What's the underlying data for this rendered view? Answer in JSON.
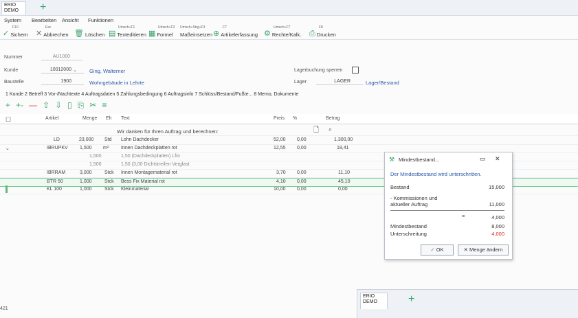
{
  "app": {
    "tab_title_line1": "ERIO",
    "tab_title_line2": "DEMO",
    "new_tab": "+"
  },
  "menu": [
    "System",
    "Bearbeiten",
    "Ansicht",
    "Funktionen"
  ],
  "toolbar": [
    {
      "key": "F10",
      "label": "Sichern",
      "icon": "check-icon",
      "color": "#3aa36a"
    },
    {
      "key": "Esc",
      "label": "Abbrechen",
      "icon": "close-icon",
      "color": "#777"
    },
    {
      "key": "",
      "label": "Löschen",
      "icon": "trash-icon",
      "color": "#3aa36a"
    },
    {
      "key": "Umsch+F1",
      "label": "Texteditieren",
      "icon": "text-edit-icon",
      "color": "#3aa36a"
    },
    {
      "key": "Umsch+F3",
      "label": "Formel",
      "icon": "formula-icon",
      "color": "#3aa36a"
    },
    {
      "key": "Umsch+Strg+F3",
      "label": "Maßeinsetzen",
      "icon": "measure-icon",
      "color": "#3aa36a"
    },
    {
      "key": "F7",
      "label": "Artikelerfassung",
      "icon": "add-circle-icon",
      "color": "#3aa36a"
    },
    {
      "key": "Umsch+F7",
      "label": "Rechte/Kalk.",
      "icon": "gear-icon",
      "color": "#3aa36a"
    },
    {
      "key": "F8",
      "label": "Drucken",
      "icon": "printer-icon",
      "color": "#3aa36a"
    }
  ],
  "fields": {
    "nummer_label": "Nummer",
    "nummer_value": "AU1000",
    "kunde_label": "Kunde",
    "kunde_value": "10012000",
    "kunde_name": "Ging, Walterner",
    "baustelle_label": "Baustelle",
    "baustelle_value": "1900",
    "baustelle_name": "Wohngebäude in Lehrte",
    "lager_check_label": "Lagerbuchung sperren",
    "lager_label": "Lager",
    "lager_value": "LAGER",
    "lager_link": "Lager/Bestand"
  },
  "tabs_line": "1 Kunde  2 Betreff  3 Vor-/Nachtexte  4 Auftragsdaten  5 Zahlungsbedingung  6 Auftragsinfo  7 Schlüss/Bestand/Fußte...  8 Memo, Dokumente",
  "actions": [
    "+",
    "+-",
    "—",
    "⇧",
    "⇩",
    "▯",
    "⎘",
    "✂",
    "≡"
  ],
  "columns": [
    "Artikel",
    "Menge",
    "Eh",
    "Text",
    "Preis",
    "%",
    "Betrag"
  ],
  "rows": [
    {
      "artikel": "",
      "menge": "",
      "eh": "",
      "text": "Wir danken für Ihren Auftrag und berechnen:",
      "preis": "",
      "pct": "",
      "betrag": ""
    },
    {
      "artikel": "LD",
      "menge": "23,000",
      "eh": "Std",
      "text": "Lohn Dachdecker",
      "preis": "52,00",
      "pct": "0,00",
      "betrag": "1.300,00"
    },
    {
      "artikel": "IBRUPKV",
      "menge": "1,500",
      "eh": "m²",
      "text": "Innen Dachdeckplatten rot",
      "preis": "12,55",
      "pct": "0,00",
      "betrag": "18,41"
    },
    {
      "artikel": "",
      "menge": "1,500",
      "eh": "",
      "text": "1,50 (Dachdeckplatten) Lfm",
      "preis": "",
      "pct": "",
      "betrag": ""
    },
    {
      "artikel": "",
      "menge": "1,500",
      "eh": "",
      "text": "1,50 (3,00 Dichtstreifen Verglast",
      "preis": "",
      "pct": "",
      "betrag": ""
    },
    {
      "artikel": "IBRRAM",
      "menge": "3,000",
      "eh": "Stck",
      "text": "Innen Montagematerial rot",
      "preis": "3,70",
      "pct": "0,00",
      "betrag": "11,10"
    },
    {
      "artikel": "BTR 50",
      "menge": "1,000",
      "eh": "Stck",
      "text": "Bess Fix Material rot",
      "preis": "4,10",
      "pct": "0,00",
      "betrag": "45,10"
    },
    {
      "artikel": "KL 100",
      "menge": "1,000",
      "eh": "Stck",
      "text": "Kleinmaterial",
      "preis": "10,00",
      "pct": "0,00",
      "betrag": "0,00"
    }
  ],
  "dialog": {
    "title": "Mindestbestand...",
    "message": "Der Mindestbestand wird unterschritten.",
    "bestand_label": "Bestand",
    "bestand_value": "15,000",
    "komm_label_1": "- Kommissionen und",
    "komm_label_2": "aktueller Auftrag",
    "komm_value": "11,000",
    "minus": "=",
    "result_value": "4,000",
    "mindest_label": "Mindestbestand",
    "mindest_value": "8,000",
    "unter_label": "Unterschreitung",
    "unter_value": "4,000",
    "ok_label": "OK",
    "menge_label": "Menge ändern",
    "accent": "#d0342c"
  },
  "mini_window": {
    "title_line1": "ERIO",
    "title_line2": "DEMO",
    "plus": "+"
  },
  "status": "421"
}
